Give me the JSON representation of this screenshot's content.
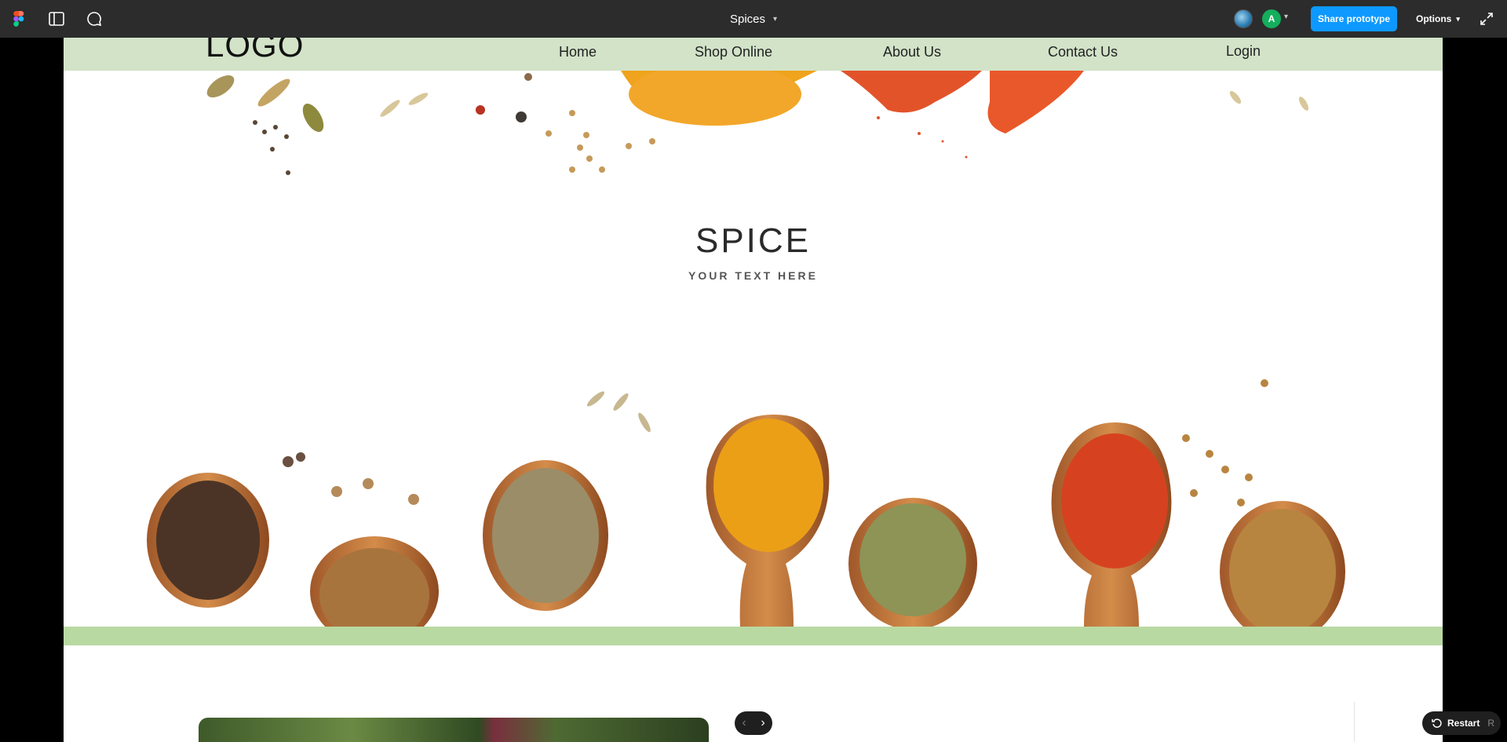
{
  "toolbar": {
    "file_title": "Spices",
    "avatar_initial": "A",
    "share_label": "Share prototype",
    "options_label": "Options",
    "accent_color": "#0d99ff",
    "icons": [
      "figma-logo-icon",
      "sidebar-toggle-icon",
      "comment-icon",
      "chevron-down-icon",
      "expand-icon"
    ]
  },
  "site": {
    "logo": "LOGO",
    "nav": [
      "Home",
      "Shop Online",
      "About Us",
      "Contact Us",
      "Login"
    ],
    "nav_color": "#d2e3c8",
    "hero_title": "SPICE",
    "hero_subtitle": "YOUR TEXT HERE",
    "band_color": "#b9d9a2"
  },
  "player": {
    "restart_label": "Restart",
    "restart_key": "R"
  }
}
